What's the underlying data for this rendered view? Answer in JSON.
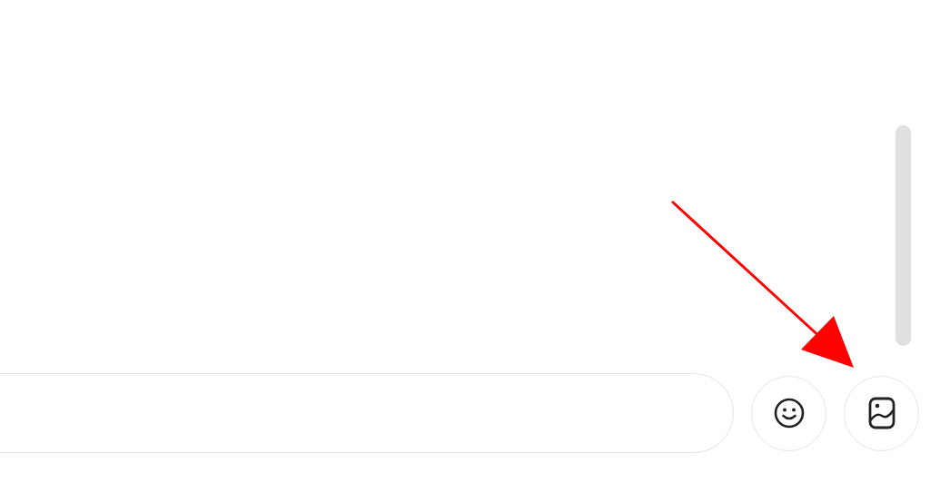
{
  "composer": {
    "buttons": [
      {
        "kind": "emoji"
      },
      {
        "kind": "image"
      }
    ]
  },
  "annotation": {
    "kind": "arrow"
  }
}
